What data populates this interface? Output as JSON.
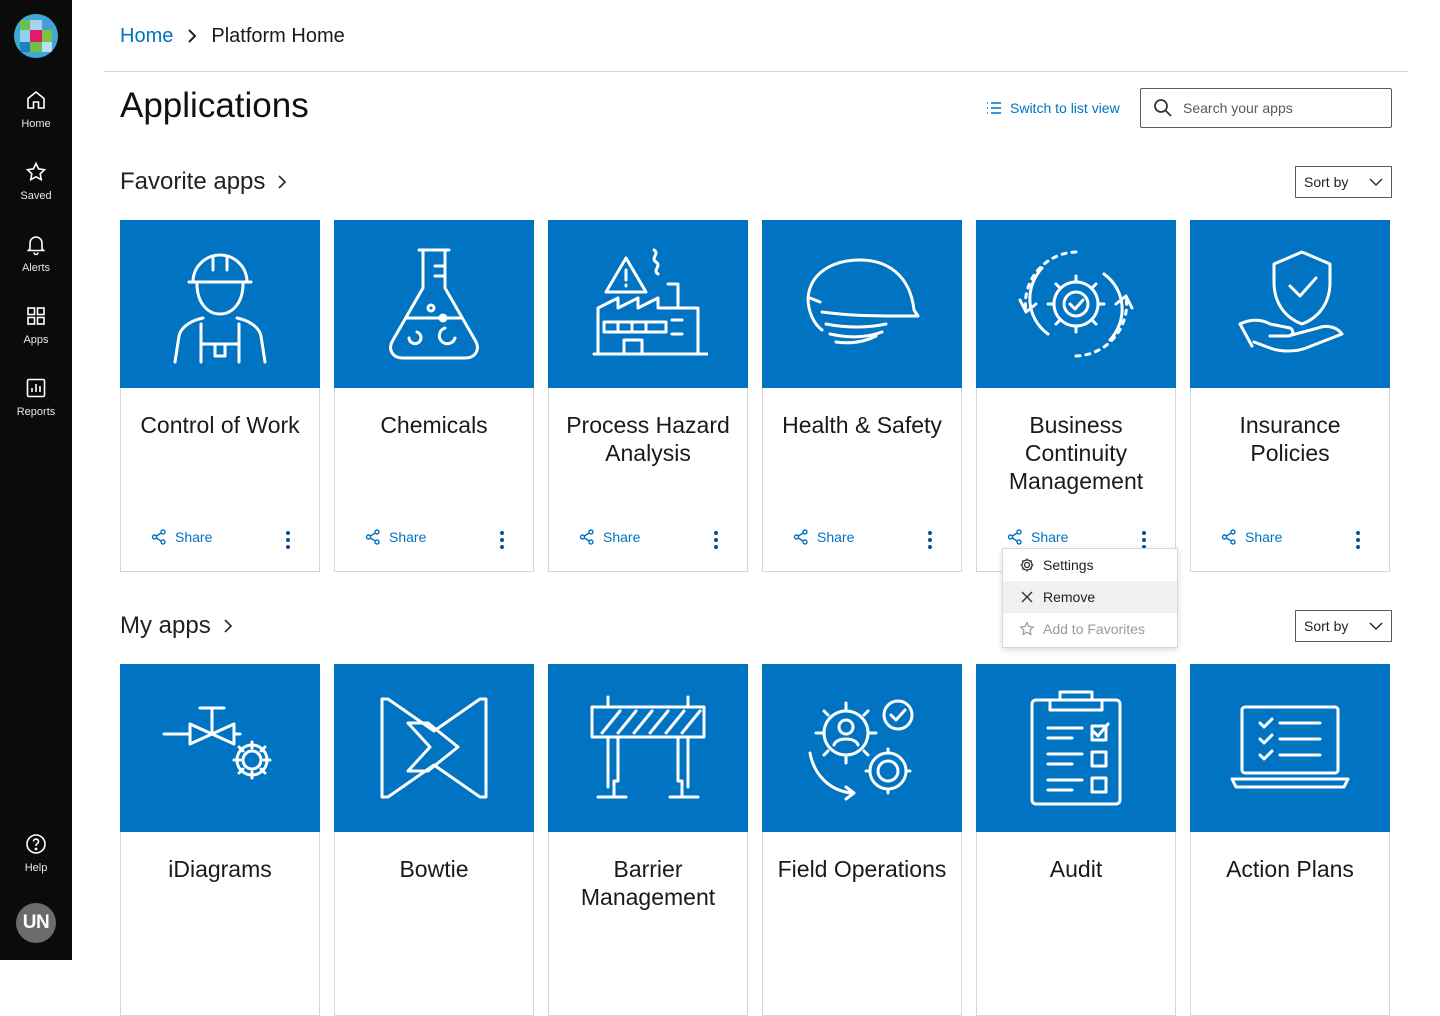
{
  "colors": {
    "brand_blue": "#0073c3",
    "sidebar_bg": "#0b0b0b",
    "card_border": "#d6d6d6"
  },
  "sidebar": {
    "logo_icon": "logo-mosaic-icon",
    "items": [
      {
        "label": "Home",
        "icon": "home-icon"
      },
      {
        "label": "Saved",
        "icon": "star-icon"
      },
      {
        "label": "Alerts",
        "icon": "bell-icon"
      },
      {
        "label": "Apps",
        "icon": "grid-icon"
      },
      {
        "label": "Reports",
        "icon": "chart-icon"
      }
    ],
    "help": {
      "label": "Help",
      "icon": "help-icon"
    },
    "avatar_initials": "UN"
  },
  "breadcrumb": {
    "home": "Home",
    "current": "Platform Home"
  },
  "page": {
    "title": "Applications",
    "switch_view": "Switch to list view",
    "search_placeholder": "Search your apps"
  },
  "favorites": {
    "title": "Favorite apps",
    "sort_label": "Sort by",
    "cards": [
      {
        "title": "Control of Work",
        "share": "Share",
        "icon": "worker-hardhat-icon"
      },
      {
        "title": "Chemicals",
        "share": "Share",
        "icon": "flask-icon"
      },
      {
        "title": "Process Hazard Analysis",
        "share": "Share",
        "icon": "factory-warning-icon"
      },
      {
        "title": "Health & Safety",
        "share": "Share",
        "icon": "hardhat-icon"
      },
      {
        "title": "Business Continuity Management",
        "share": "Share",
        "icon": "gear-cycle-icon"
      },
      {
        "title": "Insurance Policies",
        "share": "Share",
        "icon": "shield-hand-icon"
      }
    ]
  },
  "menu": {
    "items": [
      "Settings",
      "Remove",
      "Add to Favorites"
    ]
  },
  "my_apps": {
    "title": "My apps",
    "sort_label": "Sort by",
    "cards": [
      {
        "title": "iDiagrams",
        "icon": "valve-gear-icon"
      },
      {
        "title": "Bowtie",
        "icon": "bowtie-icon"
      },
      {
        "title": "Barrier Management",
        "icon": "barrier-icon"
      },
      {
        "title": "Field Operations",
        "icon": "gears-user-icon"
      },
      {
        "title": "Audit",
        "icon": "clipboard-icon"
      },
      {
        "title": "Action Plans",
        "icon": "laptop-checklist-icon"
      }
    ]
  }
}
